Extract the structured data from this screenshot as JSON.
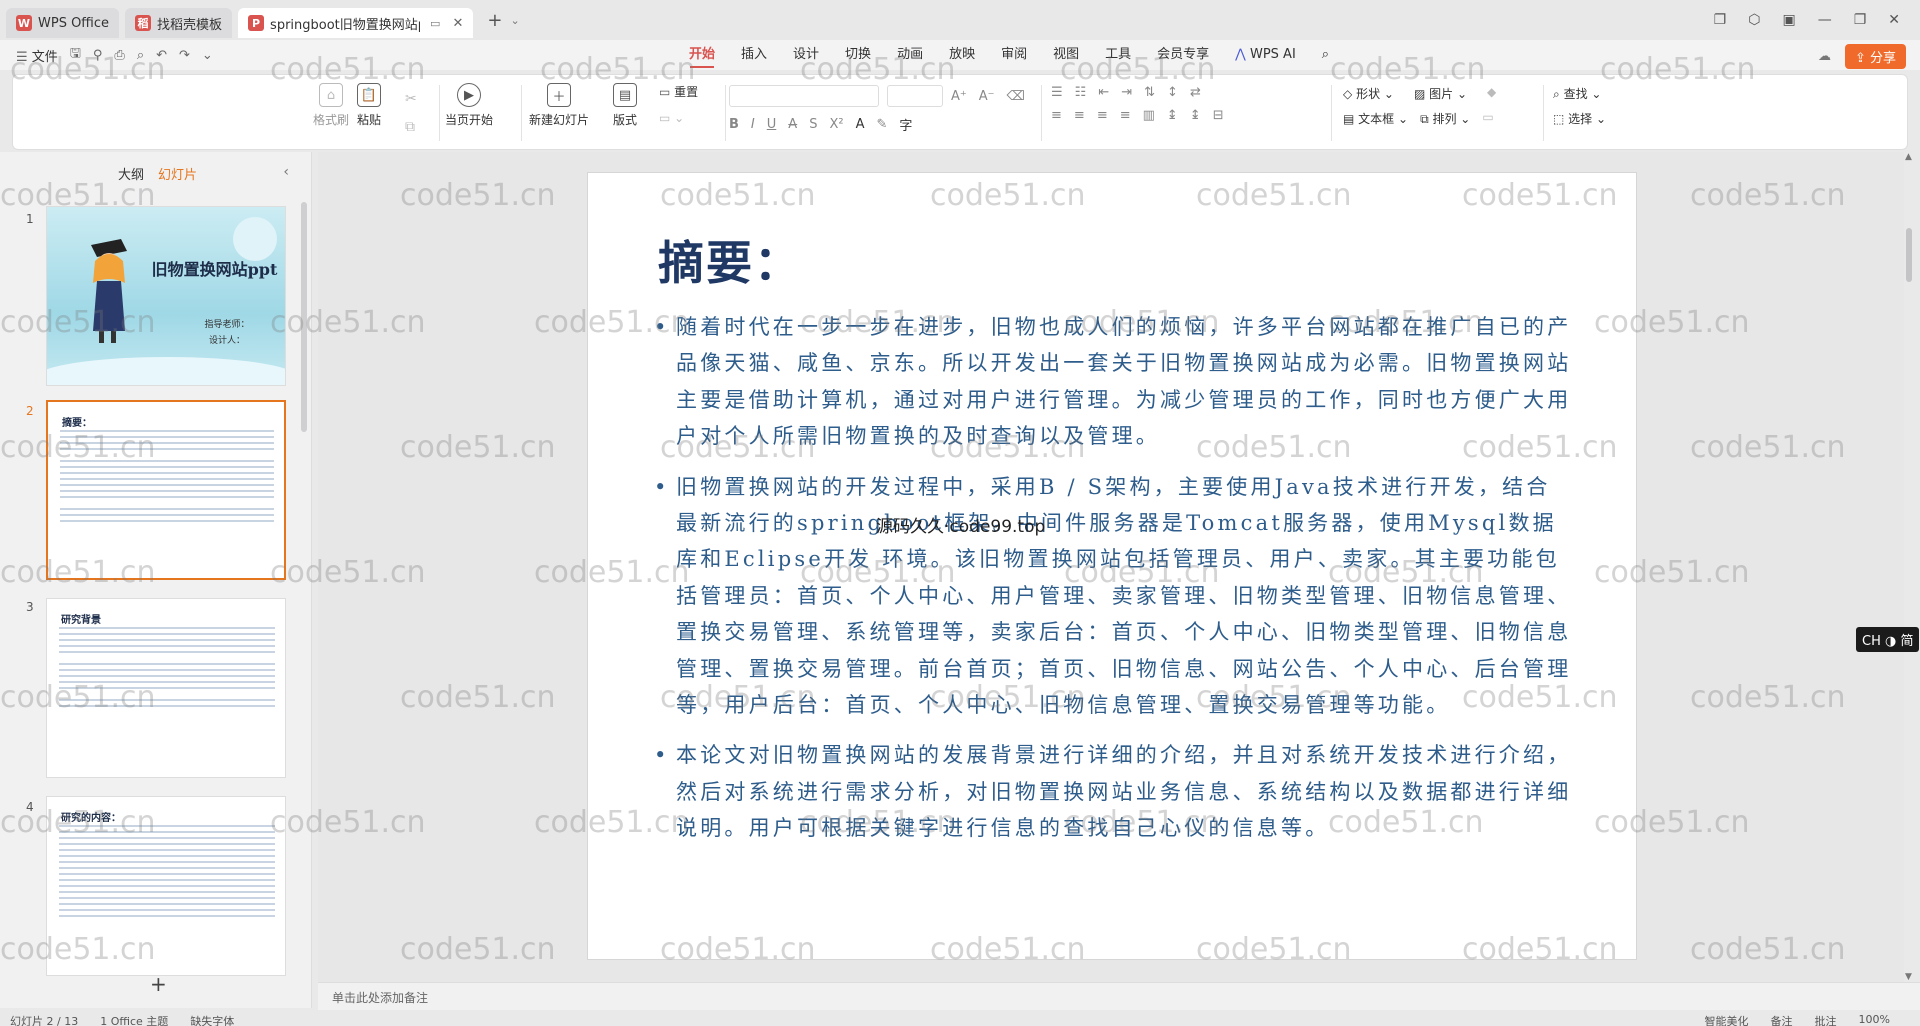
{
  "titlebar": {
    "tabs": [
      {
        "label": "WPS Office",
        "logo": "W",
        "color": "#d9534f"
      },
      {
        "label": "找稻壳模板",
        "logo": "稻",
        "color": "#d9534f"
      },
      {
        "label": "springboot旧物置换网站ppt",
        "logo": "P",
        "color": "#d9534f"
      }
    ]
  },
  "menubar": {
    "file_label": "文件",
    "tabs": [
      "开始",
      "插入",
      "设计",
      "切换",
      "动画",
      "放映",
      "审阅",
      "视图",
      "工具",
      "会员专享"
    ],
    "active_tab": "开始",
    "ai_label": "WPS AI",
    "share_label": "分享"
  },
  "ribbon": {
    "format_painter": "格式刷",
    "paste": "粘贴",
    "play_from_current": "当页开始",
    "new_slide": "新建幻灯片",
    "layout": "版式",
    "reset": "重置",
    "shape": "形状",
    "picture": "图片",
    "find": "查找",
    "textbox": "文本框",
    "arrange": "排列",
    "select": "选择"
  },
  "sidebar": {
    "tabs": [
      "大纲",
      "幻灯片"
    ],
    "active_tab": "幻灯片",
    "slides": [
      {
        "num": "1",
        "title": "旧物置换网站ppt",
        "sub1": "指导老师：",
        "sub2": "设计人："
      },
      {
        "num": "2",
        "title": "摘要："
      },
      {
        "num": "3",
        "title": "研究背景"
      },
      {
        "num": "4",
        "title": "研究的内容："
      }
    ]
  },
  "slide": {
    "title": "摘要：",
    "bullets": [
      "随着时代在一步一步在进步，旧物也成人们的烦恼，许多平台网站都在推广自已的产品像天猫、咸鱼、京东。所以开发出一套关于旧物置换网站成为必需。旧物置换网站主要是借助计算机，通过对用户进行管理。为减少管理员的工作，同时也方便广大用户对个人所需旧物置换的及时查询以及管理。",
      "旧物置换网站的开发过程中，采用B / S架构，主要使用Java技术进行开发，结合最新流行的springboot框架。中间件服务器是Tomcat服务器，使用Mysql数据库和Eclipse开发 环境。该旧物置换网站包括管理员、用户、卖家。其主要功能包括管理员：首页、个人中心、用户管理、卖家管理、旧物类型管理、旧物信息管理、置换交易管理、系统管理等，卖家后台：首页、个人中心、旧物类型管理、旧物信息管理、置换交易管理。前台首页；首页、旧物信息、网站公告、个人中心、后台管理等，用户后台：首页、个人中心、旧物信息管理、置换交易管理等功能。",
      "本论文对旧物置换网站的发展背景进行详细的介绍，并且对系统开发技术进行介绍，然后对系统进行需求分析，对旧物置换网站业务信息、系统结构以及数据都进行详细说明。用户可根据关键字进行信息的查找自己心仪的信息等。"
    ],
    "overlay_text": "源码久久·code99.top"
  },
  "notes_placeholder": "单击此处添加备注",
  "ime_label": "CH ◑ 简",
  "watermark_text": "code51.cn",
  "statusbar": {
    "left": [
      "幻灯片 2 / 13",
      "1 Office 主题",
      "缺失字体"
    ],
    "right": [
      "智能美化",
      "备注",
      "批注",
      "100%"
    ]
  }
}
